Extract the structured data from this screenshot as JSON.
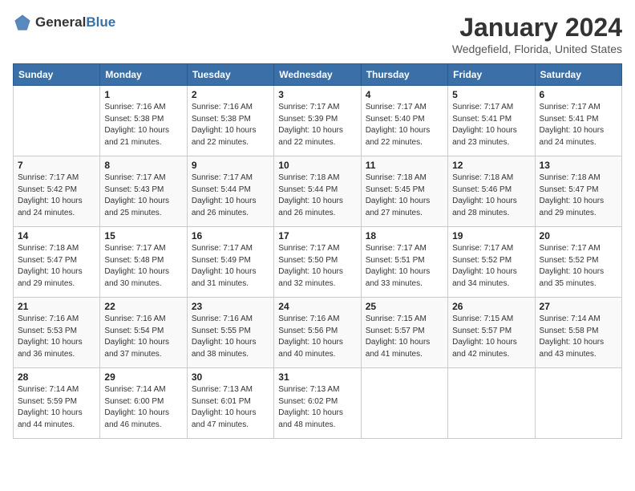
{
  "logo": {
    "text_general": "General",
    "text_blue": "Blue"
  },
  "header": {
    "month_title": "January 2024",
    "location": "Wedgefield, Florida, United States"
  },
  "weekdays": [
    "Sunday",
    "Monday",
    "Tuesday",
    "Wednesday",
    "Thursday",
    "Friday",
    "Saturday"
  ],
  "weeks": [
    [
      {
        "day": "",
        "sunrise": "",
        "sunset": "",
        "daylight": ""
      },
      {
        "day": "1",
        "sunrise": "Sunrise: 7:16 AM",
        "sunset": "Sunset: 5:38 PM",
        "daylight": "Daylight: 10 hours and 21 minutes."
      },
      {
        "day": "2",
        "sunrise": "Sunrise: 7:16 AM",
        "sunset": "Sunset: 5:38 PM",
        "daylight": "Daylight: 10 hours and 22 minutes."
      },
      {
        "day": "3",
        "sunrise": "Sunrise: 7:17 AM",
        "sunset": "Sunset: 5:39 PM",
        "daylight": "Daylight: 10 hours and 22 minutes."
      },
      {
        "day": "4",
        "sunrise": "Sunrise: 7:17 AM",
        "sunset": "Sunset: 5:40 PM",
        "daylight": "Daylight: 10 hours and 22 minutes."
      },
      {
        "day": "5",
        "sunrise": "Sunrise: 7:17 AM",
        "sunset": "Sunset: 5:41 PM",
        "daylight": "Daylight: 10 hours and 23 minutes."
      },
      {
        "day": "6",
        "sunrise": "Sunrise: 7:17 AM",
        "sunset": "Sunset: 5:41 PM",
        "daylight": "Daylight: 10 hours and 24 minutes."
      }
    ],
    [
      {
        "day": "7",
        "sunrise": "Sunrise: 7:17 AM",
        "sunset": "Sunset: 5:42 PM",
        "daylight": "Daylight: 10 hours and 24 minutes."
      },
      {
        "day": "8",
        "sunrise": "Sunrise: 7:17 AM",
        "sunset": "Sunset: 5:43 PM",
        "daylight": "Daylight: 10 hours and 25 minutes."
      },
      {
        "day": "9",
        "sunrise": "Sunrise: 7:17 AM",
        "sunset": "Sunset: 5:44 PM",
        "daylight": "Daylight: 10 hours and 26 minutes."
      },
      {
        "day": "10",
        "sunrise": "Sunrise: 7:18 AM",
        "sunset": "Sunset: 5:44 PM",
        "daylight": "Daylight: 10 hours and 26 minutes."
      },
      {
        "day": "11",
        "sunrise": "Sunrise: 7:18 AM",
        "sunset": "Sunset: 5:45 PM",
        "daylight": "Daylight: 10 hours and 27 minutes."
      },
      {
        "day": "12",
        "sunrise": "Sunrise: 7:18 AM",
        "sunset": "Sunset: 5:46 PM",
        "daylight": "Daylight: 10 hours and 28 minutes."
      },
      {
        "day": "13",
        "sunrise": "Sunrise: 7:18 AM",
        "sunset": "Sunset: 5:47 PM",
        "daylight": "Daylight: 10 hours and 29 minutes."
      }
    ],
    [
      {
        "day": "14",
        "sunrise": "Sunrise: 7:18 AM",
        "sunset": "Sunset: 5:47 PM",
        "daylight": "Daylight: 10 hours and 29 minutes."
      },
      {
        "day": "15",
        "sunrise": "Sunrise: 7:17 AM",
        "sunset": "Sunset: 5:48 PM",
        "daylight": "Daylight: 10 hours and 30 minutes."
      },
      {
        "day": "16",
        "sunrise": "Sunrise: 7:17 AM",
        "sunset": "Sunset: 5:49 PM",
        "daylight": "Daylight: 10 hours and 31 minutes."
      },
      {
        "day": "17",
        "sunrise": "Sunrise: 7:17 AM",
        "sunset": "Sunset: 5:50 PM",
        "daylight": "Daylight: 10 hours and 32 minutes."
      },
      {
        "day": "18",
        "sunrise": "Sunrise: 7:17 AM",
        "sunset": "Sunset: 5:51 PM",
        "daylight": "Daylight: 10 hours and 33 minutes."
      },
      {
        "day": "19",
        "sunrise": "Sunrise: 7:17 AM",
        "sunset": "Sunset: 5:52 PM",
        "daylight": "Daylight: 10 hours and 34 minutes."
      },
      {
        "day": "20",
        "sunrise": "Sunrise: 7:17 AM",
        "sunset": "Sunset: 5:52 PM",
        "daylight": "Daylight: 10 hours and 35 minutes."
      }
    ],
    [
      {
        "day": "21",
        "sunrise": "Sunrise: 7:16 AM",
        "sunset": "Sunset: 5:53 PM",
        "daylight": "Daylight: 10 hours and 36 minutes."
      },
      {
        "day": "22",
        "sunrise": "Sunrise: 7:16 AM",
        "sunset": "Sunset: 5:54 PM",
        "daylight": "Daylight: 10 hours and 37 minutes."
      },
      {
        "day": "23",
        "sunrise": "Sunrise: 7:16 AM",
        "sunset": "Sunset: 5:55 PM",
        "daylight": "Daylight: 10 hours and 38 minutes."
      },
      {
        "day": "24",
        "sunrise": "Sunrise: 7:16 AM",
        "sunset": "Sunset: 5:56 PM",
        "daylight": "Daylight: 10 hours and 40 minutes."
      },
      {
        "day": "25",
        "sunrise": "Sunrise: 7:15 AM",
        "sunset": "Sunset: 5:57 PM",
        "daylight": "Daylight: 10 hours and 41 minutes."
      },
      {
        "day": "26",
        "sunrise": "Sunrise: 7:15 AM",
        "sunset": "Sunset: 5:57 PM",
        "daylight": "Daylight: 10 hours and 42 minutes."
      },
      {
        "day": "27",
        "sunrise": "Sunrise: 7:14 AM",
        "sunset": "Sunset: 5:58 PM",
        "daylight": "Daylight: 10 hours and 43 minutes."
      }
    ],
    [
      {
        "day": "28",
        "sunrise": "Sunrise: 7:14 AM",
        "sunset": "Sunset: 5:59 PM",
        "daylight": "Daylight: 10 hours and 44 minutes."
      },
      {
        "day": "29",
        "sunrise": "Sunrise: 7:14 AM",
        "sunset": "Sunset: 6:00 PM",
        "daylight": "Daylight: 10 hours and 46 minutes."
      },
      {
        "day": "30",
        "sunrise": "Sunrise: 7:13 AM",
        "sunset": "Sunset: 6:01 PM",
        "daylight": "Daylight: 10 hours and 47 minutes."
      },
      {
        "day": "31",
        "sunrise": "Sunrise: 7:13 AM",
        "sunset": "Sunset: 6:02 PM",
        "daylight": "Daylight: 10 hours and 48 minutes."
      },
      {
        "day": "",
        "sunrise": "",
        "sunset": "",
        "daylight": ""
      },
      {
        "day": "",
        "sunrise": "",
        "sunset": "",
        "daylight": ""
      },
      {
        "day": "",
        "sunrise": "",
        "sunset": "",
        "daylight": ""
      }
    ]
  ]
}
